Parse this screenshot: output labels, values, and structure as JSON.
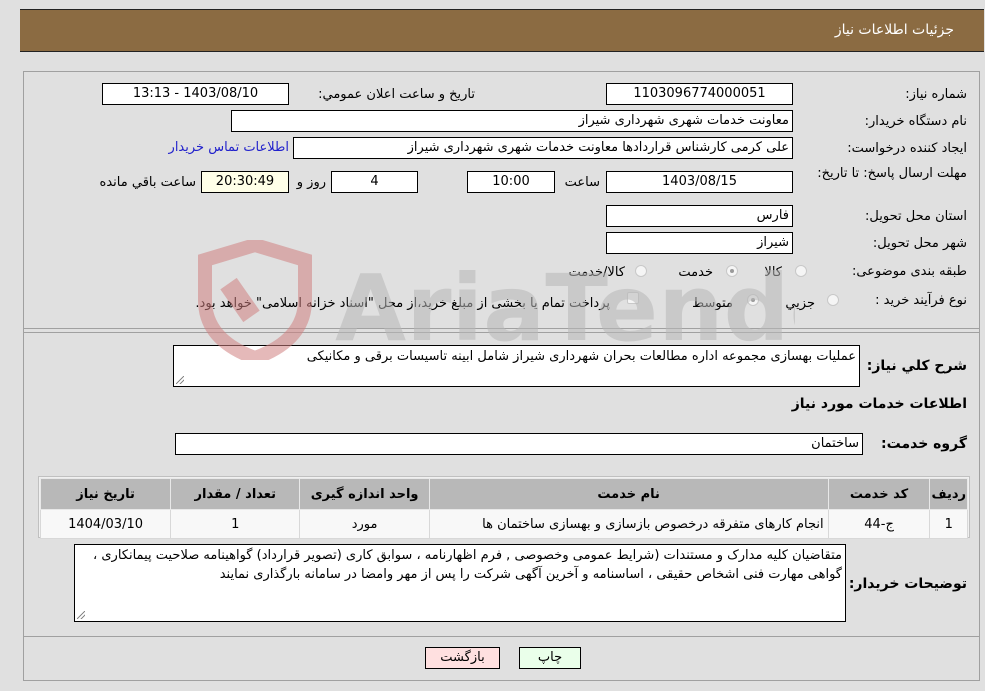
{
  "header": {
    "title": "جزئیات اطلاعات نیاز"
  },
  "fields": {
    "need_number_label": "شماره نیاز:",
    "need_number": "1103096774000051",
    "announce_label": "تاریخ و ساعت اعلان عمومي:",
    "announce_value": "1403/08/10 - 13:13",
    "buyer_org_label": "نام دستگاه خریدار:",
    "buyer_org": "معاونت خدمات شهری شهرداری شیراز",
    "creator_label": "ایجاد کننده درخواست:",
    "creator": "علی کرمی کارشناس قراردادها معاونت خدمات شهری شهرداری شیراز",
    "contact_link": "اطلاعات تماس خریدار",
    "deadline_label": "مهلت ارسال پاسخ: تا تاریخ:",
    "deadline_date": "1403/08/15",
    "time_label": "ساعت",
    "deadline_time": "10:00",
    "days_value": "4",
    "days_label": "روز و",
    "remaining_time": "20:30:49",
    "remaining_label": "ساعت باقي مانده",
    "province_label": "استان محل تحویل:",
    "province": "فارس",
    "city_label": "شهر محل تحویل:",
    "city": "شیراز",
    "category_label": "طبقه بندی موضوعی:",
    "category_options": [
      "کالا",
      "خدمت",
      "کالا/خدمت"
    ],
    "category_selected": "خدمت",
    "process_label": "نوع فرآیند خرید :",
    "process_options": [
      "جزيي",
      "متوسط"
    ],
    "process_selected": "متوسط",
    "payment_note": "پرداخت تمام یا بخشی از مبلغ خرید،از محل \"اسناد خزانه اسلامی\" خواهد بود."
  },
  "description": {
    "label": "شرح کلي نیاز:",
    "value": "عملیات بهسازی مجموعه اداره مطالعات بحران شهرداری شیراز شامل ابینه تاسیسات برقی و مکانیکی"
  },
  "services": {
    "section_title": "اطلاعات خدمات مورد نیاز",
    "group_label": "گروه خدمت:",
    "group_value": "ساختمان",
    "table": {
      "headers": [
        "ردیف",
        "کد خدمت",
        "نام خدمت",
        "واحد اندازه گیری",
        "تعداد / مقدار",
        "تاریخ نیاز"
      ],
      "rows": [
        [
          "1",
          "ج-44",
          "انجام کارهای متفرقه درخصوص بازسازی و بهسازی ساختمان ها",
          "مورد",
          "1",
          "1404/03/10"
        ]
      ]
    }
  },
  "buyer_notes": {
    "label": "توضیحات خریدار:",
    "value": "متقاضیان کلیه مدارک و مستندات (شرایط عمومی وخصوصی , فرم اظهارنامه ، سوابق کاری (تصویر قرارداد) گواهینامه صلاحیت پیمانکاری ، گواهی مهارت فنی اشخاص حقیقی ، اساسنامه و آخرین آگهی شرکت را پس از مهر وامضا در سامانه بارگذاری نمایند"
  },
  "buttons": {
    "print": "چاپ",
    "back": "بازگشت"
  },
  "watermark": {
    "text": "AriaTender.neT"
  },
  "colors": {
    "header_bg": "#8b6b42",
    "print_bg": "#eaffea",
    "back_bg": "#ffe0e0",
    "link": "#2222cc"
  }
}
